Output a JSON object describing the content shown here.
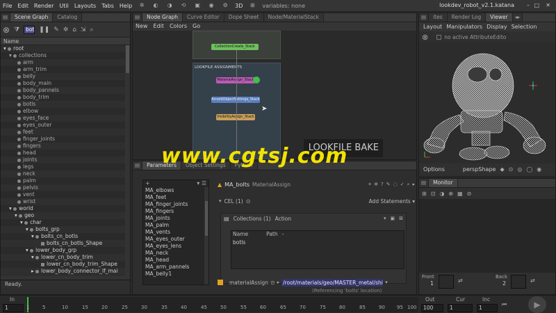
{
  "menubar": {
    "items": [
      "File",
      "Edit",
      "Render",
      "Util",
      "Layouts",
      "Tabs",
      "Help"
    ],
    "mode_3d": "3D",
    "variables": "variables: none",
    "window_title": "lookdev_robot_v2.1.katana"
  },
  "scene_graph": {
    "tabs": [
      "Scene Graph",
      "Catalog"
    ],
    "filter": "bot",
    "column_header": "Name",
    "rows": [
      "root",
      "collections",
      "arm",
      "arm_trim",
      "belly",
      "body_main",
      "body_pannels",
      "body_trim",
      "botls",
      "elbow",
      "eyes_face",
      "eyes_outer",
      "feet",
      "finger_joints",
      "fingers",
      "head",
      "joints",
      "legs",
      "neck",
      "palm",
      "pelvis",
      "vent",
      "wrist",
      "world",
      "geo",
      "char",
      "bolts_grp",
      "bolts_cn_botls",
      "bolts_cn_botls_Shape",
      "lower_body_grp",
      "lower_cn_body_trim",
      "lower_cn_body_trim_Shape",
      "lower_body_connector_lf_mai"
    ],
    "status": "Ready."
  },
  "node_graph": {
    "tabs": [
      "Node Graph",
      "Curve Editor",
      "Dope Sheet",
      "Node/MaterialStack"
    ],
    "menu": [
      "New",
      "Edit",
      "Colors",
      "Go"
    ],
    "backdrop_label": "LOOKFILE ASSIGNMENTS",
    "nodes": [
      "CollectionCreate_Stack",
      "MaterialAssign_Stack",
      "ArnoldObjectSettings_Stack",
      "VisibilityAssign_Stack"
    ],
    "overlay_text": "LOOKFILE BAKE"
  },
  "parameters": {
    "tabs": [
      "Parameters",
      "Object Settings",
      "Python"
    ],
    "list_items": [
      "MA_elbows",
      "MA_feet",
      "MA_finger_joints",
      "MA_fingers",
      "MA_joints",
      "MA_palm",
      "MA_vents",
      "MA_eyes_outer",
      "MA_eyes_lens",
      "MA_neck",
      "MA_head",
      "MA_arm_pannels",
      "MA_belly1"
    ],
    "node_name": "MA_bolts",
    "node_type": "MaterialAssign",
    "cel_label": "CEL (1)",
    "add_statements": "Add Statements",
    "collections_label": "Collections (1)",
    "action_label": "Action",
    "col_name": "Name",
    "col_path": "Path",
    "col_dash": "-",
    "entry": "botls",
    "material_assign_label": "materialAssign",
    "material_path": "/root/materials/geo/MASTER_metal/shiny/l",
    "referencing": "(Referencing 'bolts' location)"
  },
  "viewer": {
    "tabs": [
      "ites",
      "Render Log",
      "Viewer"
    ],
    "menu": [
      "Layout",
      "Manipulators",
      "Display",
      "Selection"
    ],
    "attribute_editor": "no active AttributeEdito",
    "options": "Options",
    "camera": "perspShape"
  },
  "monitor": {
    "title": "Monitor",
    "front_label": "Front",
    "front_value": "1",
    "back_label": "Back",
    "back_value": "2"
  },
  "timeline": {
    "in_label": "In",
    "in_value": "1",
    "ticks": [
      "1",
      "5",
      "10",
      "15",
      "20",
      "25",
      "30",
      "35",
      "40",
      "45",
      "50",
      "55",
      "60",
      "65",
      "70",
      "75",
      "80",
      "85",
      "90",
      "95",
      "100"
    ],
    "out_label": "Out",
    "out_value": "100",
    "cur_label": "Cur",
    "cur_value": "1",
    "inc_label": "Inc",
    "inc_value": "1"
  },
  "watermark": "www.cgtsj.com",
  "colors": {
    "accent": "#4a9bd6",
    "watermark": "#f2e200",
    "material_node": "#b95bb5",
    "arnold_node": "#5a7fc0",
    "visibility_node": "#c9a05a",
    "collection_node": "#6fbf5f"
  }
}
